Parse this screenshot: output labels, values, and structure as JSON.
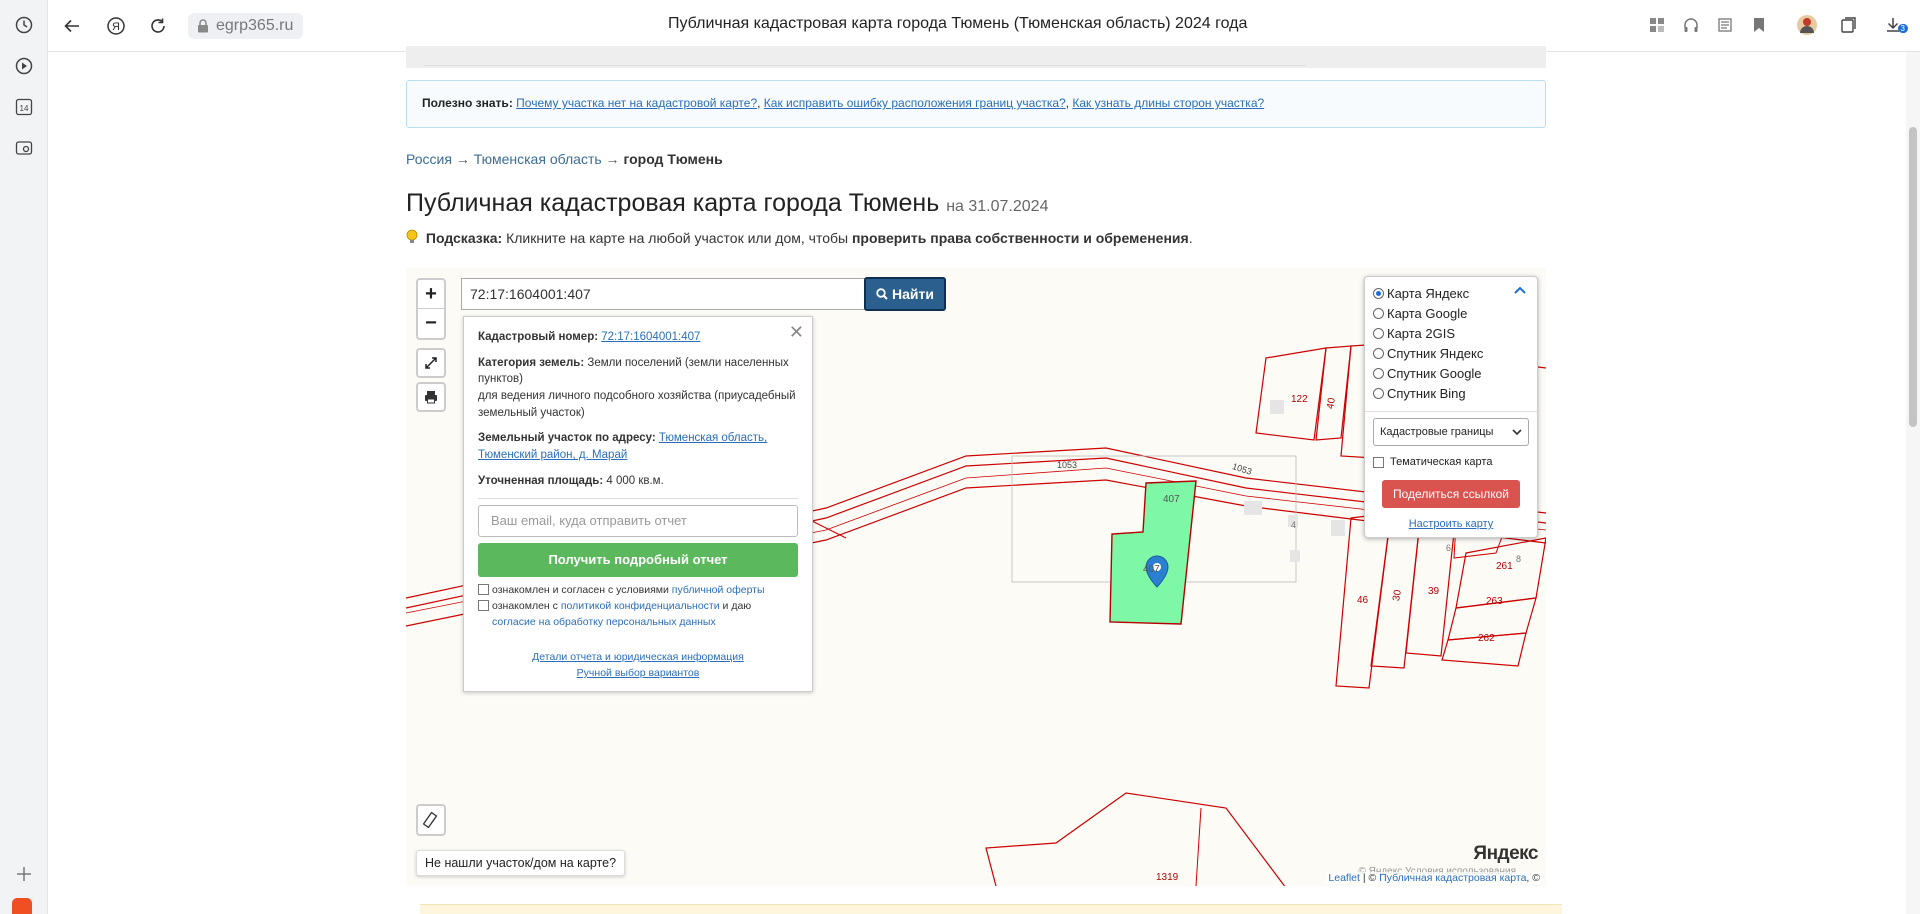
{
  "browser": {
    "url": "egrp365.ru",
    "title": "Публичная кадастровая карта города Тюмень (Тюменская область) 2024 года",
    "sidebar_badge": "14",
    "downloads_count": "3"
  },
  "info": {
    "label": "Полезно знать:",
    "links": [
      "Почему участка нет на кадастровой карте?",
      "Как исправить ошибку расположения границ участка?",
      "Как узнать длины сторон участка?"
    ]
  },
  "breadcrumbs": {
    "items": [
      "Россия",
      "Тюменская область"
    ],
    "current": "город Тюмень",
    "separator": "→"
  },
  "heading": {
    "title": "Публичная кадастровая карта города Тюмень",
    "date": "на 31.07.2024"
  },
  "hint": {
    "label": "Подсказка:",
    "text": "Кликните на карте на любой участок или дом, чтобы",
    "bold": "проверить права собственности и обременения",
    "end": "."
  },
  "search": {
    "value": "72:17:1604001:407",
    "button": "Найти"
  },
  "popup": {
    "cad_label": "Кадастровый номер:",
    "cad_value": "72:17:1604001:407",
    "cat_label": "Категория земель:",
    "cat_value": "Земли поселений (земли населенных пунктов)",
    "use_value": "для ведения личного подсобного хозяйства (приусадебный земельный участок)",
    "addr_label": "Земельный участок по адресу:",
    "addr_value": "Тюменская область, Тюменский район, д. Марай",
    "area_label": "Уточненная площадь:",
    "area_value": "4 000 кв.м.",
    "email_placeholder": "Ваш email, куда отправить отчет",
    "get_report": "Получить подробный отчет",
    "agree1_text": "ознакомлен и согласен с условиями",
    "agree1_link": "публичной оферты",
    "agree2_text": "ознакомлен с",
    "agree2_link": "политикой конфиденциальности",
    "agree2_mid": "и даю",
    "agree2_link2": "согласие на обработку персональных данных",
    "details_link": "Детали отчета и юридическая информация",
    "manual_link": "Ручной выбор вариантов"
  },
  "layers": {
    "options": [
      "Карта Яндекс",
      "Карта Google",
      "Карта 2GIS",
      "Спутник Яндекс",
      "Спутник Google",
      "Спутник Bing"
    ],
    "selected_index": 0,
    "select_value": "Кадастровые границы",
    "thematic_label": "Тематическая карта",
    "share_button": "Поделиться ссылкой",
    "configure_link": "Настроить карту"
  },
  "map": {
    "not_found": "Не нашли участок/дом на карте?",
    "yandex_logo": "Яндекс",
    "yandex_terms": "© Яндекс Условия использования",
    "attr_leaflet": "Leaflet",
    "attr_sep": "| ©",
    "attr_pkk": "Публичная кадастровая карта",
    "attr_end": ", ©",
    "parcel_labels": [
      "407",
      "407",
      "1053",
      "1053",
      "122",
      "40",
      "4",
      "6",
      "8",
      "261",
      "263",
      "262",
      "46",
      "30",
      "39",
      "1319"
    ],
    "parcel_fill": "#7ef7a6",
    "boundary_color": "#cc0000"
  }
}
